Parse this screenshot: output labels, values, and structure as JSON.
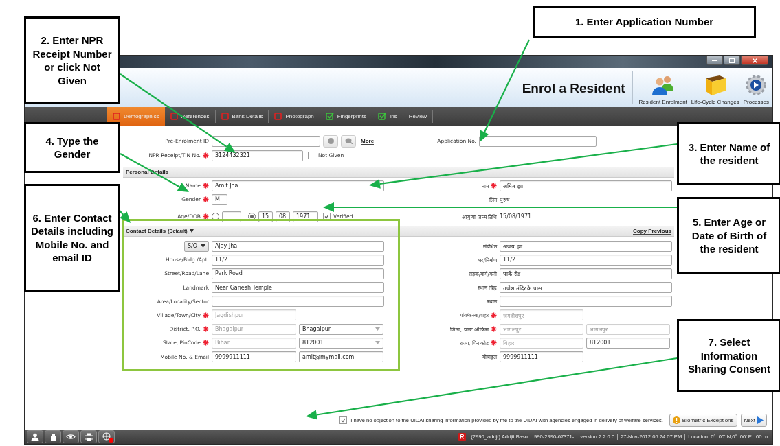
{
  "header": {
    "title": "Enrol a Resident",
    "actions": [
      {
        "label": "Resident Enrolment",
        "kind": "people"
      },
      {
        "label": "Life-Cycle Changes",
        "kind": "box"
      },
      {
        "label": "Processes",
        "kind": "gear"
      }
    ]
  },
  "tabs": [
    {
      "label": "Demographics",
      "selected": true,
      "kind": "pending"
    },
    {
      "label": "References",
      "selected": false,
      "kind": "pending"
    },
    {
      "label": "Bank Details",
      "selected": false,
      "kind": "pending"
    },
    {
      "label": "Photograph",
      "selected": false,
      "kind": "pending"
    },
    {
      "label": "Fingerprints",
      "selected": false,
      "kind": "done"
    },
    {
      "label": "Iris",
      "selected": false,
      "kind": "done"
    },
    {
      "label": "Review",
      "selected": false,
      "kind": "plain"
    }
  ],
  "ids": {
    "pre_enrolment": {
      "label": "Pre-Enrolment ID"
    },
    "more_link": "More",
    "application": {
      "label": "Application No."
    },
    "npr": {
      "label": "NPR Receipt/TIN No.",
      "required": true,
      "value": "3124432321"
    },
    "not_given": {
      "label": "Not Given",
      "checked": false
    }
  },
  "personal": {
    "title": "Personal Details",
    "name": {
      "label": "Name",
      "required": true,
      "value": "Amit Jha"
    },
    "gender": {
      "label": "Gender",
      "required": true,
      "value": "M"
    },
    "age_dob": {
      "label": "Age/DOB",
      "required": true,
      "age_option": {
        "selected": false
      },
      "dob_option": {
        "selected": true
      },
      "day": "15",
      "month": "08",
      "year": "1971",
      "verified": {
        "label": "Verified",
        "checked": true
      }
    },
    "local_name": {
      "label": "नाम",
      "required": true,
      "value": "अमित झा"
    },
    "local_gender": {
      "label": "लिंग",
      "value": "पुरुष"
    },
    "local_dob": {
      "label": "आयु या जन्म तिथि",
      "value": "15/08/1971"
    }
  },
  "contact": {
    "title": "Contact Details",
    "suffix": "(Default)",
    "copy_link": "Copy Previous",
    "rows": [
      {
        "left": {
          "kind": "relation",
          "relation": "S/O",
          "fields": [
            {
              "kind": "wide",
              "value": "Ajay Jha"
            }
          ]
        },
        "right": {
          "label": "संबंधित",
          "fields": [
            {
              "kind": "wide",
              "value": "अजय झा"
            }
          ]
        }
      },
      {
        "left": {
          "label": "House/Bldg./Apt.",
          "fields": [
            {
              "kind": "wide",
              "value": "11/2"
            }
          ]
        },
        "right": {
          "label": "घर/निर्माण",
          "fields": [
            {
              "kind": "wide",
              "value": "11/2"
            }
          ]
        }
      },
      {
        "left": {
          "label": "Street/Road/Lane",
          "fields": [
            {
              "kind": "wide",
              "value": "Park Road"
            }
          ]
        },
        "right": {
          "label": "सड़क/मार्ग/गली",
          "fields": [
            {
              "kind": "wide",
              "value": "पार्क रोड"
            }
          ]
        }
      },
      {
        "left": {
          "label": "Landmark",
          "fields": [
            {
              "kind": "wide",
              "value": "Near Ganesh Temple"
            }
          ]
        },
        "right": {
          "label": "स्थान चिह्न",
          "fields": [
            {
              "kind": "wide",
              "value": "गणेश मंदिर के पास"
            }
          ]
        }
      },
      {
        "left": {
          "label": "Area/Locality/Sector",
          "fields": [
            {
              "kind": "wide"
            }
          ]
        },
        "right": {
          "label": "स्थान",
          "fields": [
            {
              "kind": "wide"
            }
          ]
        }
      },
      {
        "left": {
          "label": "Village/Town/City",
          "required": true,
          "fields": [
            {
              "kind": "narrow",
              "placeholder": "Jagdishpur"
            }
          ]
        },
        "right": {
          "label": "गांव/कस्बा/शहर",
          "required": true,
          "fields": [
            {
              "kind": "narrow",
              "placeholder": "जगदीशपुर"
            }
          ]
        }
      },
      {
        "left": {
          "label": "District, P.O.",
          "required": true,
          "fields": [
            {
              "kind": "narrow",
              "placeholder": "Bhagalpur"
            },
            {
              "kind": "dropdown",
              "value": "Bhagalpur"
            }
          ]
        },
        "right": {
          "label": "जिला, पोस्ट ऑफिस",
          "required": true,
          "fields": [
            {
              "kind": "narrow",
              "placeholder": "भागलपुर"
            },
            {
              "kind": "narrow",
              "placeholder": "भागलपुर"
            }
          ]
        }
      },
      {
        "left": {
          "label": "State, PinCode",
          "required": true,
          "fields": [
            {
              "kind": "narrow",
              "placeholder": "Bihar"
            },
            {
              "kind": "dropdown",
              "value": "812001"
            }
          ]
        },
        "right": {
          "label": "राज्य, पिन कोड",
          "required": true,
          "fields": [
            {
              "kind": "narrow",
              "placeholder": "बिहार"
            },
            {
              "kind": "narrow",
              "value": "812001"
            }
          ]
        }
      },
      {
        "left": {
          "label": "Mobile No. & Email",
          "fields": [
            {
              "kind": "narrow",
              "value": "9999911111"
            },
            {
              "kind": "narrow",
              "value": "amit@mymail.com"
            }
          ]
        },
        "right": {
          "label": "मोबाइल",
          "fields": [
            {
              "kind": "narrow",
              "value": "9999911111"
            }
          ]
        }
      }
    ]
  },
  "consent": {
    "checked": true,
    "text": "I have no objection to the UIDAI sharing information provided by me to the UIDAI with agencies engaged in delivery of welfare services."
  },
  "buttons": [
    {
      "label": "Biometric Exceptions",
      "kind": "warning"
    },
    {
      "label": "Next",
      "kind": "next"
    }
  ],
  "status_bar": {
    "tools": [
      {
        "kind": "person"
      },
      {
        "kind": "hand"
      },
      {
        "kind": "eye"
      },
      {
        "kind": "printer"
      },
      {
        "kind": "network",
        "alert": true
      }
    ],
    "items": [
      "(2990_adrijt) Adrijit Basu",
      "990-2990-67371-",
      "version 2.2.0.0",
      "27-Nov-2012 05:24:07 PM",
      "Location: 0° .00' N,0° .00' E: .00 m"
    ]
  },
  "callouts": [
    {
      "text": "1. Enter Application Number"
    },
    {
      "text": "2. Enter NPR Receipt Number or click Not Given"
    },
    {
      "text": "3. Enter Name of the resident"
    },
    {
      "text": "4. Type the Gender"
    },
    {
      "text": "6. Enter Contact Details including Mobile No. and email ID"
    },
    {
      "text": "5. Enter Age or Date of Birth of the resident"
    },
    {
      "text": "7. Select Information Sharing Consent"
    }
  ]
}
